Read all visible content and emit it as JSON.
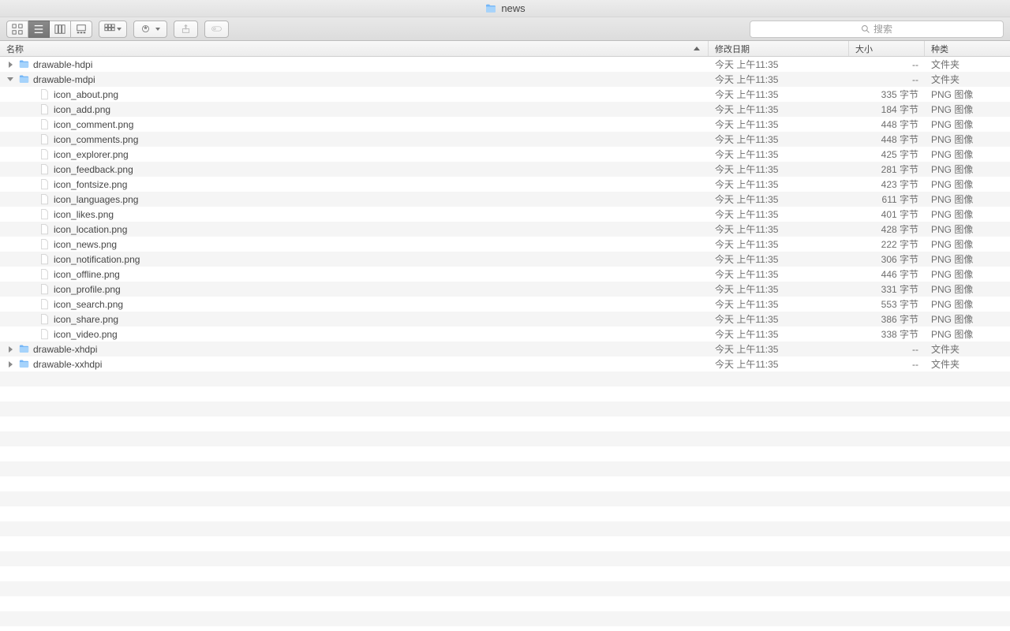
{
  "window": {
    "title": "news"
  },
  "toolbar": {
    "search_placeholder": "搜索"
  },
  "columns": {
    "name": "名称",
    "date": "修改日期",
    "size": "大小",
    "kind": "种类"
  },
  "shared": {
    "date": "今天 上午11:35",
    "folder_size": "--",
    "folder_kind": "文件夹",
    "png_kind": "PNG 图像"
  },
  "rows": [
    {
      "type": "folder",
      "depth": 0,
      "expanded": false,
      "name": "drawable-hdpi"
    },
    {
      "type": "folder",
      "depth": 0,
      "expanded": true,
      "name": "drawable-mdpi"
    },
    {
      "type": "png",
      "depth": 1,
      "name": "icon_about.png",
      "size": "335 字节"
    },
    {
      "type": "png",
      "depth": 1,
      "name": "icon_add.png",
      "size": "184 字节"
    },
    {
      "type": "png",
      "depth": 1,
      "name": "icon_comment.png",
      "size": "448 字节"
    },
    {
      "type": "png",
      "depth": 1,
      "name": "icon_comments.png",
      "size": "448 字节"
    },
    {
      "type": "png",
      "depth": 1,
      "name": "icon_explorer.png",
      "size": "425 字节"
    },
    {
      "type": "png",
      "depth": 1,
      "name": "icon_feedback.png",
      "size": "281 字节"
    },
    {
      "type": "png",
      "depth": 1,
      "name": "icon_fontsize.png",
      "size": "423 字节"
    },
    {
      "type": "png",
      "depth": 1,
      "name": "icon_languages.png",
      "size": "611 字节"
    },
    {
      "type": "png",
      "depth": 1,
      "name": "icon_likes.png",
      "size": "401 字节"
    },
    {
      "type": "png",
      "depth": 1,
      "name": "icon_location.png",
      "size": "428 字节"
    },
    {
      "type": "png",
      "depth": 1,
      "name": "icon_news.png",
      "size": "222 字节"
    },
    {
      "type": "png",
      "depth": 1,
      "name": "icon_notification.png",
      "size": "306 字节"
    },
    {
      "type": "png",
      "depth": 1,
      "name": "icon_offline.png",
      "size": "446 字节"
    },
    {
      "type": "png",
      "depth": 1,
      "name": "icon_profile.png",
      "size": "331 字节"
    },
    {
      "type": "png",
      "depth": 1,
      "name": "icon_search.png",
      "size": "553 字节"
    },
    {
      "type": "png",
      "depth": 1,
      "name": "icon_share.png",
      "size": "386 字节"
    },
    {
      "type": "png",
      "depth": 1,
      "name": "icon_video.png",
      "size": "338 字节"
    },
    {
      "type": "folder",
      "depth": 0,
      "expanded": false,
      "name": "drawable-xhdpi"
    },
    {
      "type": "folder",
      "depth": 0,
      "expanded": false,
      "name": "drawable-xxhdpi"
    }
  ]
}
